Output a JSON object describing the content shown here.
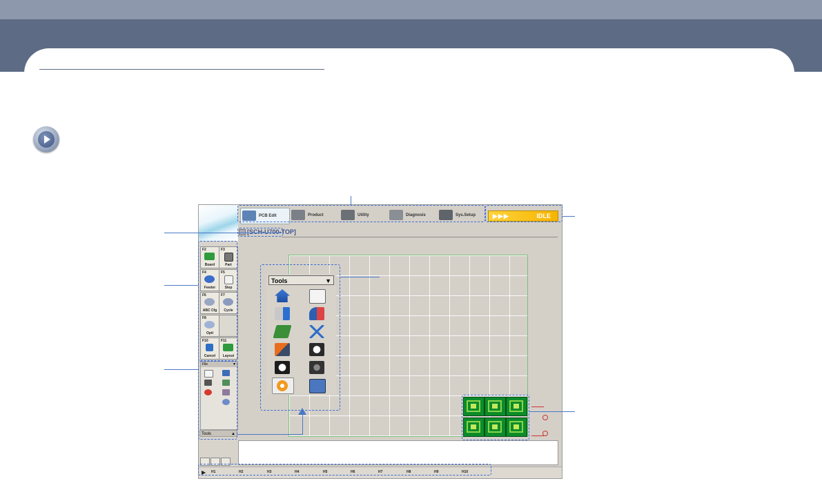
{
  "app": {
    "tabs": [
      {
        "label": "PCB Edit",
        "icon": "pcb-edit-icon",
        "active": true
      },
      {
        "label": "Product",
        "icon": "product-icon",
        "active": false
      },
      {
        "label": "Utility",
        "icon": "utility-icon",
        "active": false
      },
      {
        "label": "Diagnosis",
        "icon": "diagnosis-icon",
        "active": false
      },
      {
        "label": "Sys.Setup",
        "icon": "sys-setup-icon",
        "active": false
      }
    ],
    "status": "IDLE",
    "status_arrows": "▶▶▶",
    "board_name": "[SCH-U700-TOP]",
    "side_buttons": [
      {
        "key": "F2",
        "label": "Board"
      },
      {
        "key": "F3",
        "label": "Part"
      },
      {
        "key": "F4",
        "label": "Feeder"
      },
      {
        "key": "F5",
        "label": "Step"
      },
      {
        "key": "F6",
        "label": "ABC Cfg"
      },
      {
        "key": "F7",
        "label": "Cycle"
      },
      {
        "key": "F8",
        "label": "Opti"
      },
      {
        "key": "",
        "label": ""
      },
      {
        "key": "F10",
        "label": "Cancel"
      },
      {
        "key": "F11",
        "label": "Layout"
      }
    ],
    "file_panel_title": "File",
    "tools_bar_label": "Tools",
    "tools_popup_title": "Tools",
    "tools_popup_icons": [
      "home-icon",
      "window-target-icon",
      "clock-up-icon",
      "person-pointer-icon",
      "conveyor-board-icon",
      "axes-icon",
      "nozzle-tool-icon",
      "alert-bin-icon",
      "auto-calib-icon",
      "camera-reel-icon",
      "settings-gear-icon",
      "layers-dialog-icon"
    ],
    "hotkeys": [
      "H1",
      "H2",
      "H3",
      "H4",
      "H5",
      "H6",
      "H7",
      "H8",
      "H9",
      "H10"
    ],
    "colors": {
      "accent": "#3f5590",
      "status_bg": "#f6b400",
      "pcb_green": "#0b8c2a"
    }
  }
}
